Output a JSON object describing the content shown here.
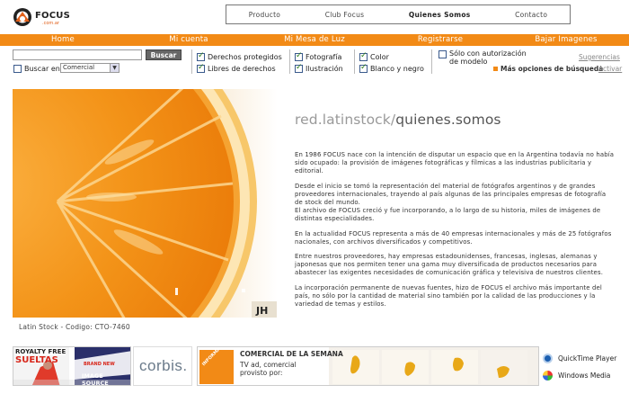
{
  "logo": {
    "name": "FOCUS",
    "sub": ".com.ar"
  },
  "topnav": [
    "Producto",
    "Club Focus",
    "Quienes Somos",
    "Contacto"
  ],
  "topnav_active": 2,
  "orangebar": [
    "Home",
    "Mi cuenta",
    "Mi Mesa de Luz",
    "Registrarse",
    "Bajar Imagenes"
  ],
  "search": {
    "value": "",
    "button": "Buscar",
    "buscar_en_label": "Buscar en",
    "buscar_en_value": "Comercial"
  },
  "filters": {
    "derechos_protegidos": "Derechos protegidos",
    "libres_de_derechos": "Libres de derechos",
    "fotografia": "Fotografía",
    "ilustracion": "Ilustración",
    "color": "Color",
    "blanco_y_negro": "Blanco y negro",
    "solo_autorizacion": "Sólo con autorización de modelo"
  },
  "links": {
    "sugerencias": "Sugerencias",
    "mas_opciones": "Más opciones de búsqueda",
    "activar": "Activar"
  },
  "main": {
    "headline_prefix": "red.latinstock/",
    "headline_rest": "quienes.somos",
    "paragraphs": [
      "En 1986 FOCUS nace con la intención de disputar un espacio que en la Argentina todavía no había sido ocupado: la provisión de imágenes fotográficas y fílmicas a las industrias publicitaria y editorial.",
      "Desde el inicio se tomó la representación del material de fotógrafos argentinos y de grandes proveedores internacionales, trayendo al país algunas de las principales empresas de fotografía de stock del mundo.\nEl archivo de FOCUS creció y fue incorporando, a lo largo de su historia, miles de imágenes de distintas especialidades.",
      "En la actualidad FOCUS representa a más de 40 empresas internacionales y más de 25 fotógrafos nacionales, con archivos diversificados y competitivos.",
      "Entre nuestros proveedores, hay empresas estadounidenses, francesas, inglesas, alemanas y japonesas que nos permiten tener una gama muy diversificada de productos necesarios para abastecer las exigentes necesidades de comunicación gráfica y televisiva de nuestros clientes.",
      "La incorporación permanente de nuevas fuentes, hizo de FOCUS el archivo más importante del país, no sólo por la cantidad de material sino también por la calidad de las producciones y la variedad de temas y estilos."
    ],
    "photo_caption": "Latin Stock - Codigo: CTO-7460",
    "photo_tag": "JH"
  },
  "ads": {
    "royalty": "ROYALTY FREE",
    "sueltas": "SUELTAS",
    "brand_new": "BRAND NEW",
    "image_source": "IMAGE SOURCE",
    "corbis": "corbis.",
    "comercial_title": "COMERCIAL DE LA SEMANA",
    "comercial_text": "TV ad, comercial provisto por:",
    "informativo": "INFORMATIVO",
    "quicktime": "QuickTime Player",
    "windows_media": "Windows Media"
  },
  "colors": {
    "accent": "#f28a16",
    "orange_fruit": "#f08a10"
  }
}
